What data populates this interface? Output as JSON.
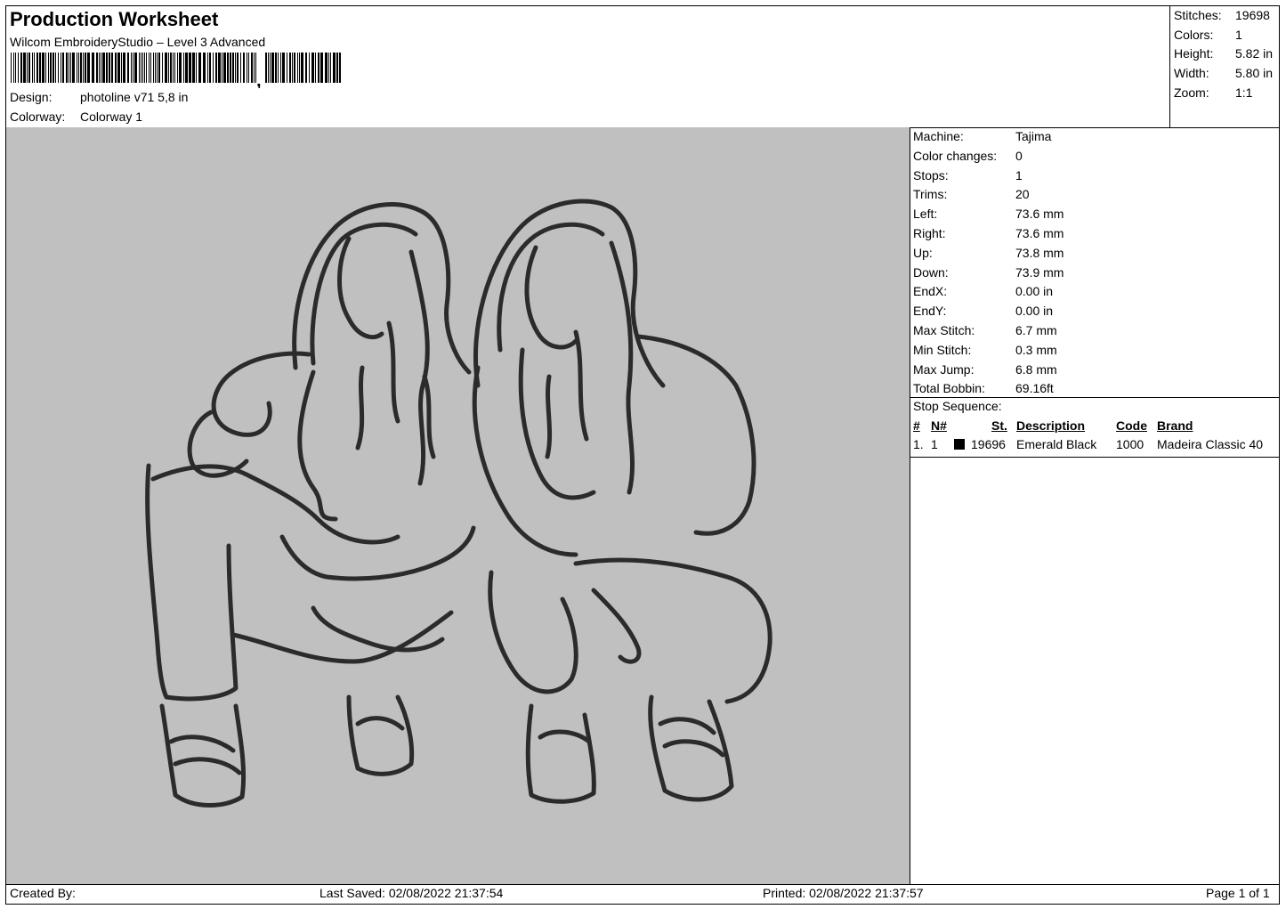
{
  "header": {
    "title": "Production Worksheet",
    "software": "Wilcom EmbroideryStudio – Level 3 Advanced",
    "design_label": "Design:",
    "design_value": "photoline v71 5,8 in",
    "colorway_label": "Colorway:",
    "colorway_value": "Colorway 1"
  },
  "summary": [
    {
      "label": "Stitches:",
      "value": "19698"
    },
    {
      "label": "Colors:",
      "value": "1"
    },
    {
      "label": "Height:",
      "value": "5.82 in"
    },
    {
      "label": "Width:",
      "value": "5.80 in"
    },
    {
      "label": "Zoom:",
      "value": "1:1"
    }
  ],
  "machine_info": [
    {
      "label": "Machine:",
      "value": "Tajima"
    },
    {
      "label": "Color changes:",
      "value": "0"
    },
    {
      "label": "Stops:",
      "value": "1"
    },
    {
      "label": "Trims:",
      "value": "20"
    },
    {
      "label": "Left:",
      "value": "73.6 mm"
    },
    {
      "label": "Right:",
      "value": "73.6 mm"
    },
    {
      "label": "Up:",
      "value": "73.8 mm"
    },
    {
      "label": "Down:",
      "value": "73.9 mm"
    },
    {
      "label": "EndX:",
      "value": "0.00 in"
    },
    {
      "label": "EndY:",
      "value": "0.00 in"
    },
    {
      "label": "Max Stitch:",
      "value": "6.7 mm"
    },
    {
      "label": "Min Stitch:",
      "value": "0.3 mm"
    },
    {
      "label": "Max Jump:",
      "value": "6.8 mm"
    },
    {
      "label": "Total Bobbin:",
      "value": "69.16ft"
    }
  ],
  "stop_sequence": {
    "title": "Stop Sequence:",
    "headers": {
      "num": "#",
      "n": "N#",
      "st": "St.",
      "description": "Description",
      "code": "Code",
      "brand": "Brand"
    },
    "rows": [
      {
        "num": "1.",
        "n": "1",
        "color": "#000000",
        "st": "19696",
        "description": "Emerald Black",
        "code": "1000",
        "brand": "Madeira Classic 40"
      }
    ]
  },
  "footer": {
    "created_by": "Created By:",
    "last_saved": "Last Saved: 02/08/2022 21:37:54",
    "printed": "Printed: 02/08/2022 21:37:57",
    "page": "Page 1 of 1"
  },
  "colors": {
    "design_background": "#c0c0c0",
    "thread": "#2b2b2b"
  }
}
